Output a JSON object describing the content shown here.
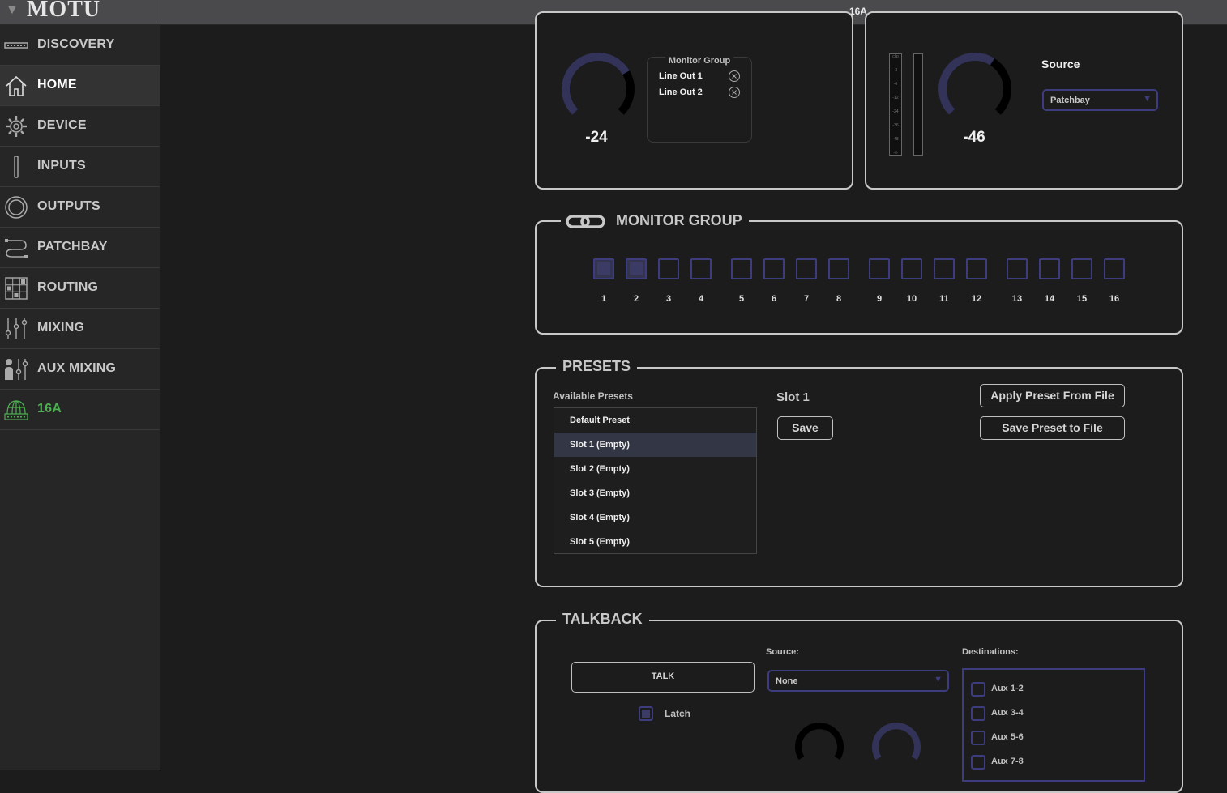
{
  "app": {
    "logo": "MOTU",
    "window_title": "16A"
  },
  "sidebar": {
    "items": [
      {
        "label": "DISCOVERY",
        "icon": "discovery-icon"
      },
      {
        "label": "HOME",
        "icon": "home-icon",
        "active": true
      },
      {
        "label": "DEVICE",
        "icon": "gear-icon"
      },
      {
        "label": "INPUTS",
        "icon": "inputs-icon"
      },
      {
        "label": "OUTPUTS",
        "icon": "outputs-icon"
      },
      {
        "label": "PATCHBAY",
        "icon": "patchbay-icon"
      },
      {
        "label": "ROUTING",
        "icon": "routing-icon"
      },
      {
        "label": "MIXING",
        "icon": "mixing-icon"
      },
      {
        "label": "AUX MIXING",
        "icon": "aux-mixing-icon"
      },
      {
        "label": "16A",
        "icon": "network-device-icon",
        "color": "#4caf50"
      }
    ]
  },
  "top_left_panel": {
    "knob_value": "-24",
    "knob_level": 0.72,
    "monitor_group_box": {
      "title": "Monitor Group",
      "items": [
        "Line Out 1",
        "Line Out 2"
      ],
      "remove_icon": "x-circle-icon"
    }
  },
  "top_right_panel": {
    "meter_labels": [
      "clip",
      "-3",
      "-6",
      "-12",
      "-24",
      "-36",
      "-48",
      "-∞"
    ],
    "knob_value": "-46",
    "knob_level": 0.62,
    "source_label": "Source",
    "source_value": "Patchbay"
  },
  "monitor_group": {
    "title": "MONITOR GROUP",
    "icon": "link-icon",
    "channels": [
      {
        "n": "1",
        "on": true
      },
      {
        "n": "2",
        "on": true
      },
      {
        "n": "3",
        "on": false
      },
      {
        "n": "4",
        "on": false
      },
      {
        "n": "5",
        "on": false
      },
      {
        "n": "6",
        "on": false
      },
      {
        "n": "7",
        "on": false
      },
      {
        "n": "8",
        "on": false
      },
      {
        "n": "9",
        "on": false
      },
      {
        "n": "10",
        "on": false
      },
      {
        "n": "11",
        "on": false
      },
      {
        "n": "12",
        "on": false
      },
      {
        "n": "13",
        "on": false
      },
      {
        "n": "14",
        "on": false
      },
      {
        "n": "15",
        "on": false
      },
      {
        "n": "16",
        "on": false
      }
    ]
  },
  "presets": {
    "title": "PRESETS",
    "available_label": "Available Presets",
    "list": [
      "Default Preset",
      "Slot 1 (Empty)",
      "Slot 2 (Empty)",
      "Slot 3 (Empty)",
      "Slot 4 (Empty)",
      "Slot 5 (Empty)"
    ],
    "selected_index": 1,
    "slot_label": "Slot 1",
    "save_label": "Save",
    "apply_from_file_label": "Apply Preset From File",
    "save_to_file_label": "Save Preset to File"
  },
  "talkback": {
    "title": "TALKBACK",
    "talk_label": "TALK",
    "latch_label": "Latch",
    "latch_checked": true,
    "source_label": "Source:",
    "source_value": "None",
    "destinations_label": "Destinations:",
    "destinations": [
      {
        "label": "Aux 1-2",
        "checked": false
      },
      {
        "label": "Aux 3-4",
        "checked": false
      },
      {
        "label": "Aux 5-6",
        "checked": false
      },
      {
        "label": "Aux 7-8",
        "checked": false
      }
    ]
  },
  "colors": {
    "accent": "#3c3c7e",
    "device_green": "#4caf50",
    "knob_arc": "#33335a"
  }
}
